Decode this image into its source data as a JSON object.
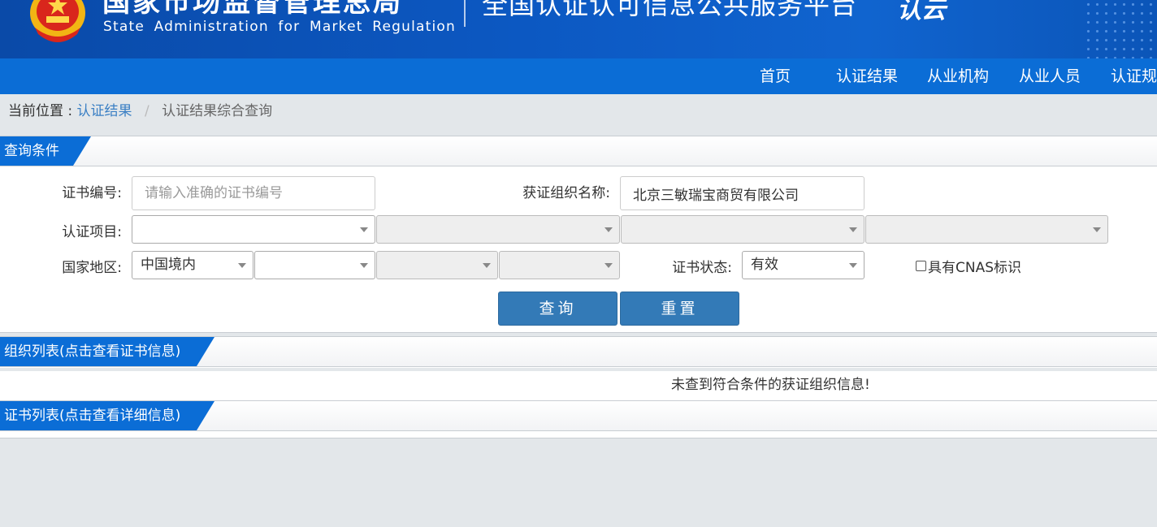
{
  "header": {
    "agency_cn": "国家市场监督管理总局",
    "agency_en": "State Administration for Market Regulation",
    "platform_title": "全国认证认可信息公共服务平台",
    "logo_text": "认云"
  },
  "nav": {
    "items": [
      "首页",
      "认证结果",
      "从业机构",
      "从业人员",
      "认证规"
    ]
  },
  "breadcrumb": {
    "label": "当前位置 :",
    "link": "认证结果",
    "separator": "/",
    "current": "认证结果综合查询"
  },
  "query": {
    "section_title": "查询条件",
    "cert_no_label": "证书编号:",
    "cert_no_placeholder": "请输入准确的证书编号",
    "cert_no_value": "",
    "org_name_label": "获证组织名称:",
    "org_name_value": "北京三敏瑞宝商贸有限公司",
    "project_label": "认证项目:",
    "region_label": "国家地区:",
    "region_value": "中国境内",
    "status_label": "证书状态:",
    "status_value": "有效",
    "cnas_label": "具有CNAS标识",
    "query_button": "查询",
    "reset_button": "重置"
  },
  "org_list": {
    "section_title": "组织列表(点击查看证书信息)",
    "empty_message": "未查到符合条件的获证组织信息!"
  },
  "cert_list": {
    "section_title": "证书列表(点击查看详细信息)"
  },
  "colors": {
    "header_blue": "#0c58c2",
    "nav_blue": "#0b6dd6",
    "button_blue": "#337ab7",
    "link_blue": "#3a7fc4"
  }
}
